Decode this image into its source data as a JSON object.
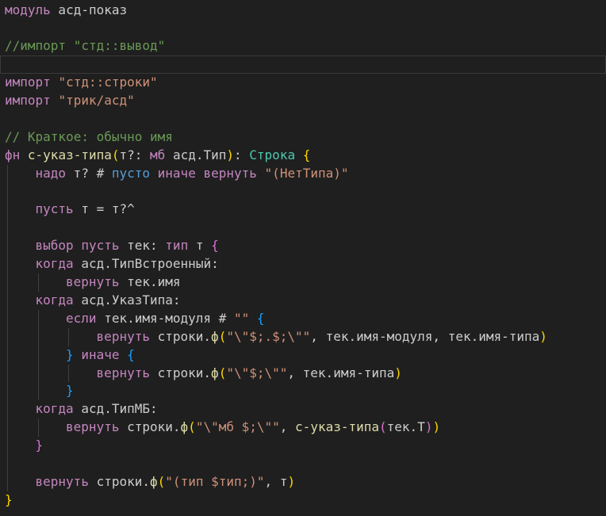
{
  "colors": {
    "background": "#1f1f1f",
    "keyword": "#c586c0",
    "string": "#ce9178",
    "comment": "#6a9955",
    "function": "#dcdcaa",
    "type": "#4ec9b0",
    "constant": "#569cd6",
    "plain": "#cccccc",
    "bracket_level_1": "#ffd700",
    "bracket_level_2": "#da70d6",
    "bracket_level_3": "#179fff",
    "indent_guide": "#404040"
  },
  "editor": {
    "lines": [
      {
        "indent": 0,
        "tokens": [
          {
            "t": "модуль",
            "c": "kw"
          },
          {
            "t": " асд-показ",
            "c": "plain"
          }
        ]
      },
      {
        "indent": 0,
        "tokens": []
      },
      {
        "indent": 0,
        "tokens": [
          {
            "t": "//импорт \"стд::вывод\"",
            "c": "cmt"
          }
        ]
      },
      {
        "indent": 0,
        "current": true,
        "tokens": []
      },
      {
        "indent": 0,
        "tokens": [
          {
            "t": "импорт",
            "c": "kw"
          },
          {
            "t": " ",
            "c": "plain"
          },
          {
            "t": "\"стд::строки\"",
            "c": "str"
          }
        ]
      },
      {
        "indent": 0,
        "tokens": [
          {
            "t": "импорт",
            "c": "kw"
          },
          {
            "t": " ",
            "c": "plain"
          },
          {
            "t": "\"трик/асд\"",
            "c": "str"
          }
        ]
      },
      {
        "indent": 0,
        "tokens": []
      },
      {
        "indent": 0,
        "tokens": [
          {
            "t": "// Краткое: обычно имя",
            "c": "cmt"
          }
        ]
      },
      {
        "indent": 0,
        "tokens": [
          {
            "t": "фн",
            "c": "kw"
          },
          {
            "t": " ",
            "c": "plain"
          },
          {
            "t": "с-указ-типа",
            "c": "fn"
          },
          {
            "t": "(",
            "c": "br1"
          },
          {
            "t": "т?: ",
            "c": "plain"
          },
          {
            "t": "мб",
            "c": "kw"
          },
          {
            "t": " асд.Тип",
            "c": "plain"
          },
          {
            "t": ")",
            "c": "br1"
          },
          {
            "t": ": ",
            "c": "plain"
          },
          {
            "t": "Строка",
            "c": "type"
          },
          {
            "t": " ",
            "c": "plain"
          },
          {
            "t": "{",
            "c": "br1"
          }
        ]
      },
      {
        "indent": 1,
        "tokens": [
          {
            "t": "надо",
            "c": "kw"
          },
          {
            "t": " т? # ",
            "c": "plain"
          },
          {
            "t": "пусто",
            "c": "const"
          },
          {
            "t": " ",
            "c": "plain"
          },
          {
            "t": "иначе",
            "c": "kw"
          },
          {
            "t": " ",
            "c": "plain"
          },
          {
            "t": "вернуть",
            "c": "kw"
          },
          {
            "t": " ",
            "c": "plain"
          },
          {
            "t": "\"(НетТипа)\"",
            "c": "str"
          }
        ]
      },
      {
        "indent": 1,
        "tokens": []
      },
      {
        "indent": 1,
        "tokens": [
          {
            "t": "пусть",
            "c": "kw"
          },
          {
            "t": " т = т?^",
            "c": "plain"
          }
        ]
      },
      {
        "indent": 1,
        "tokens": []
      },
      {
        "indent": 1,
        "tokens": [
          {
            "t": "выбор",
            "c": "kw"
          },
          {
            "t": " ",
            "c": "plain"
          },
          {
            "t": "пусть",
            "c": "kw"
          },
          {
            "t": " тек: ",
            "c": "plain"
          },
          {
            "t": "тип",
            "c": "kw"
          },
          {
            "t": " т ",
            "c": "plain"
          },
          {
            "t": "{",
            "c": "br2"
          }
        ]
      },
      {
        "indent": 1,
        "tokens": [
          {
            "t": "когда",
            "c": "kw"
          },
          {
            "t": " асд.ТипВстроенный:",
            "c": "plain"
          }
        ]
      },
      {
        "indent": 2,
        "tokens": [
          {
            "t": "вернуть",
            "c": "kw"
          },
          {
            "t": " тек.имя",
            "c": "plain"
          }
        ]
      },
      {
        "indent": 1,
        "tokens": [
          {
            "t": "когда",
            "c": "kw"
          },
          {
            "t": " асд.УказТипа:",
            "c": "plain"
          }
        ]
      },
      {
        "indent": 2,
        "tokens": [
          {
            "t": "если",
            "c": "kw"
          },
          {
            "t": " тек.имя-модуля # ",
            "c": "plain"
          },
          {
            "t": "\"\"",
            "c": "str"
          },
          {
            "t": " ",
            "c": "plain"
          },
          {
            "t": "{",
            "c": "br3"
          }
        ]
      },
      {
        "indent": 3,
        "tokens": [
          {
            "t": "вернуть",
            "c": "kw"
          },
          {
            "t": " строки.",
            "c": "plain"
          },
          {
            "t": "ф",
            "c": "fn"
          },
          {
            "t": "(",
            "c": "br1"
          },
          {
            "t": "\"\\\"$;.$;\\\"\"",
            "c": "str"
          },
          {
            "t": ", тек.имя-модуля, тек.имя-типа",
            "c": "plain"
          },
          {
            "t": ")",
            "c": "br1"
          }
        ]
      },
      {
        "indent": 2,
        "tokens": [
          {
            "t": "}",
            "c": "br3"
          },
          {
            "t": " ",
            "c": "plain"
          },
          {
            "t": "иначе",
            "c": "kw"
          },
          {
            "t": " ",
            "c": "plain"
          },
          {
            "t": "{",
            "c": "br3"
          }
        ]
      },
      {
        "indent": 3,
        "tokens": [
          {
            "t": "вернуть",
            "c": "kw"
          },
          {
            "t": " строки.",
            "c": "plain"
          },
          {
            "t": "ф",
            "c": "fn"
          },
          {
            "t": "(",
            "c": "br1"
          },
          {
            "t": "\"\\\"$;\\\"\"",
            "c": "str"
          },
          {
            "t": ", тек.имя-типа",
            "c": "plain"
          },
          {
            "t": ")",
            "c": "br1"
          }
        ]
      },
      {
        "indent": 2,
        "tokens": [
          {
            "t": "}",
            "c": "br3"
          }
        ]
      },
      {
        "indent": 1,
        "tokens": [
          {
            "t": "когда",
            "c": "kw"
          },
          {
            "t": " асд.ТипМБ:",
            "c": "plain"
          }
        ]
      },
      {
        "indent": 2,
        "tokens": [
          {
            "t": "вернуть",
            "c": "kw"
          },
          {
            "t": " строки.",
            "c": "plain"
          },
          {
            "t": "ф",
            "c": "fn"
          },
          {
            "t": "(",
            "c": "br1"
          },
          {
            "t": "\"\\\"мб $;\\\"\"",
            "c": "str"
          },
          {
            "t": ", ",
            "c": "plain"
          },
          {
            "t": "с-указ-типа",
            "c": "fn"
          },
          {
            "t": "(",
            "c": "br2"
          },
          {
            "t": "тек.Т",
            "c": "plain"
          },
          {
            "t": ")",
            "c": "br2"
          },
          {
            "t": ")",
            "c": "br1"
          }
        ]
      },
      {
        "indent": 1,
        "tokens": [
          {
            "t": "}",
            "c": "br2"
          }
        ]
      },
      {
        "indent": 1,
        "tokens": []
      },
      {
        "indent": 1,
        "tokens": [
          {
            "t": "вернуть",
            "c": "kw"
          },
          {
            "t": " строки.",
            "c": "plain"
          },
          {
            "t": "ф",
            "c": "fn"
          },
          {
            "t": "(",
            "c": "br1"
          },
          {
            "t": "\"(тип $тип;)\"",
            "c": "str"
          },
          {
            "t": ", т",
            "c": "plain"
          },
          {
            "t": ")",
            "c": "br1"
          }
        ]
      },
      {
        "indent": 0,
        "tokens": [
          {
            "t": "}",
            "c": "br1"
          }
        ]
      }
    ]
  }
}
